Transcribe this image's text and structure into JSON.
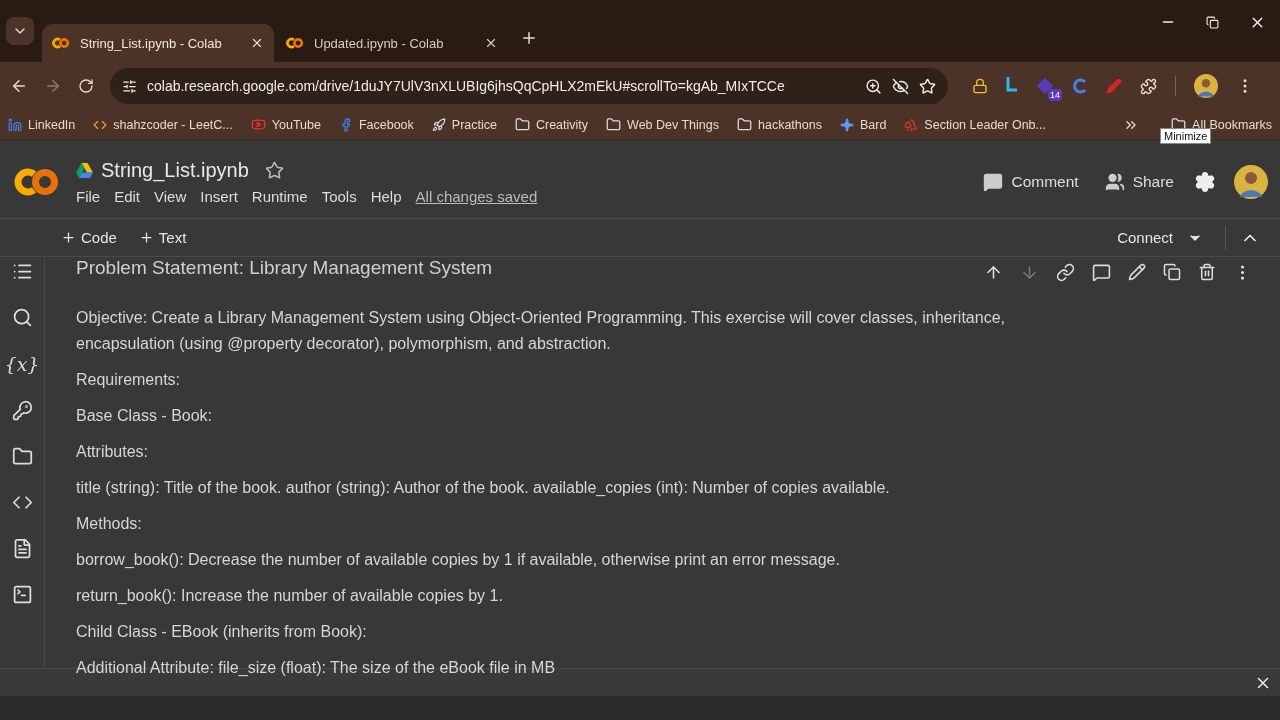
{
  "browser": {
    "tabs": [
      {
        "title": "String_List.ipynb - Colab",
        "selected": true
      },
      {
        "title": "Updated.ipynb - Colab",
        "selected": false
      }
    ],
    "url": "colab.research.google.com/drive/1duJY7UlV3nXLUBIg6jhsQqCpHLX2mEkU#scrollTo=kgAb_MIxTCCe",
    "extension_badge": "14",
    "bookmarks": [
      {
        "label": "LinkedIn",
        "kind": "linkedin"
      },
      {
        "label": "shahzcoder - LeetC...",
        "kind": "leetcode"
      },
      {
        "label": "YouTube",
        "kind": "youtube"
      },
      {
        "label": "Facebook",
        "kind": "facebook"
      },
      {
        "label": "Practice",
        "kind": "rocket"
      },
      {
        "label": "Creativity",
        "kind": "folder"
      },
      {
        "label": "Web Dev Things",
        "kind": "folder"
      },
      {
        "label": "hackathons",
        "kind": "folder"
      },
      {
        "label": "Bard",
        "kind": "bard"
      },
      {
        "label": "Section Leader Onb...",
        "kind": "tree"
      }
    ],
    "all_bookmarks": "All Bookmarks",
    "tooltip": "Minimize"
  },
  "colab": {
    "title": "String_List.ipynb",
    "menu": [
      "File",
      "Edit",
      "View",
      "Insert",
      "Runtime",
      "Tools",
      "Help"
    ],
    "save_status": "All changes saved",
    "actions": [
      {
        "label": "Comment",
        "kind": "comment"
      },
      {
        "label": "Share",
        "kind": "share"
      }
    ],
    "add_buttons": [
      "Code",
      "Text"
    ],
    "connect": "Connect",
    "sidebar": [
      {
        "kind": "toc"
      },
      {
        "kind": "search"
      },
      {
        "kind": "variables",
        "glyph": "{x}"
      },
      {
        "kind": "key"
      },
      {
        "kind": "folder"
      },
      {
        "kind": "code"
      },
      {
        "kind": "snippets"
      },
      {
        "kind": "terminal"
      }
    ],
    "cell_heading": "Problem Statement: Library Management System",
    "paragraphs": [
      "Objective: Create a Library Management System using Object-Oriented Programming. This exercise will cover classes, inheritance, encapsulation (using @property decorator), polymorphism, and abstraction.",
      "Requirements:",
      "Base Class - Book:",
      "Attributes:",
      "title (string): Title of the book. author (string): Author of the book. available_copies (int): Number of copies available.",
      "Methods:",
      "borrow_book(): Decrease the number of available copies by 1 if available, otherwise print an error message.",
      "return_book(): Increase the number of available copies by 1.",
      "Child Class - EBook (inherits from Book):",
      "Additional Attribute: file_size (float): The size of the eBook file in MB"
    ]
  }
}
